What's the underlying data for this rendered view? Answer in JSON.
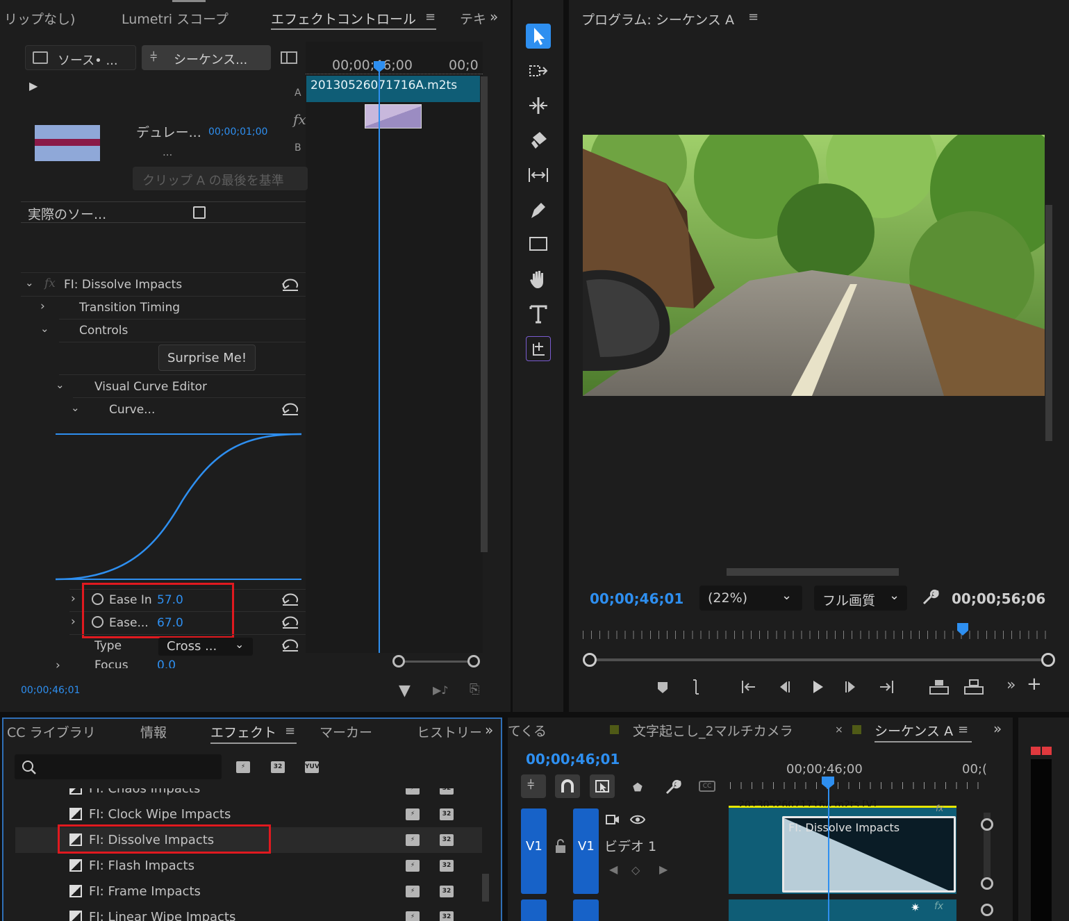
{
  "left_panel": {
    "tabs": [
      "リップなし)",
      "Lumetri スコープ",
      "エフェクトコントロール",
      "テキ"
    ],
    "source_tab": "ソース• ...",
    "sequence_tab": "シーケンス...",
    "mini_timecode_1": "00;00;46;00",
    "mini_timecode_2": "00;0",
    "clip_name": "20130526071716A.m2ts",
    "track_a": "A",
    "track_b": "B",
    "fx_label": "fx",
    "duration_label": "デュレー...",
    "duration_value": "00;00;01;00",
    "ellipsis": "...",
    "alignment_value": "クリップ A の最後を基準",
    "actual_source_label": "実際のソー...",
    "effect_name": "FI: Dissolve Impacts",
    "transition_timing": "Transition Timing",
    "controls": "Controls",
    "surprise_button": "Surprise Me!",
    "visual_curve_editor": "Visual Curve Editor",
    "curve": "Curve...",
    "ease_in_label": "Ease In",
    "ease_in_value": "57.0",
    "ease_out_label": "Ease...",
    "ease_out_value": "67.0",
    "type_label": "Type",
    "type_value": "Cross ...",
    "focus_label": "Focus",
    "focus_value": "0.0",
    "current_timecode": "00;00;46;01"
  },
  "tools": [
    "selection-tool",
    "track-select-tool",
    "ripple-edit-tool",
    "razor-tool",
    "slip-tool",
    "pen-tool",
    "rectangle-tool",
    "hand-tool",
    "type-tool",
    "custom-tool"
  ],
  "program_monitor": {
    "title": "プログラム: シーケンス A",
    "timecode": "00;00;46;01",
    "zoom": "(22%)",
    "quality": "フル画質",
    "duration": "00;00;56;06"
  },
  "effects_panel": {
    "tabs": [
      "CC ライブラリ",
      "情報",
      "エフェクト",
      "マーカー",
      "ヒストリー"
    ],
    "search_placeholder": "",
    "badge_accel": "⚡",
    "badge_32": "32",
    "badge_yuv": "YUV",
    "items": [
      "FI: Chaos Impacts",
      "FI: Clock Wipe Impacts",
      "FI: Dissolve Impacts",
      "FI: Flash Impacts",
      "FI: Frame Impacts",
      "FI: Linear Wipe Impacts"
    ]
  },
  "timeline": {
    "tabs": [
      "てくる",
      "文字起こし_2マルチカメラ",
      "シーケンス A"
    ],
    "close_mark": "×",
    "timecode": "00;00;46;01",
    "ruler_1": "00;00;46;00",
    "ruler_2": "00;(",
    "cc_label": "CC",
    "track_v1_a": "V1",
    "track_v1_b": "V1",
    "track_name": "ビデオ 1",
    "clip_top_label": "20130526071716A.m2ts [V]",
    "transition_label": "FI: Dissolve Impacts",
    "fx_mark": "fx"
  },
  "colors": {
    "accent_blue": "#2e8ff0",
    "highlight_red": "#e0191f",
    "clip_teal": "#0f5d76",
    "panel_bg": "#1d1d1d"
  }
}
